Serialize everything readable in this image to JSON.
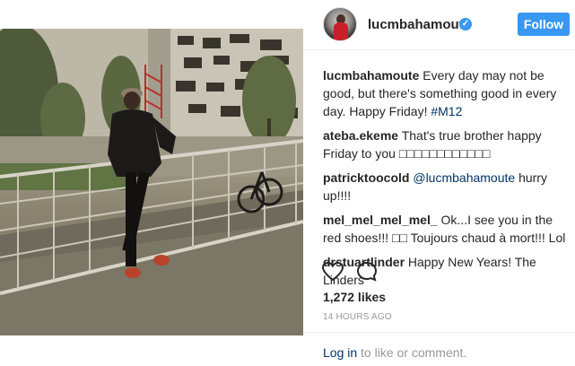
{
  "post": {
    "username": "lucmbahamoute",
    "verified_glyph": "✓",
    "follow_label": "Follow",
    "accent_color": "#3897f0",
    "comments": [
      {
        "author": "lucmbahamoute",
        "text": "Every day may not be good, but there's something good in every day. Happy Friday! ",
        "tag": "#M12"
      },
      {
        "author": "ateba.ekeme",
        "text": "That's true brother happy Friday to you □□□□□□□□□□□□",
        "tag": ""
      },
      {
        "author": "patricktoocold",
        "text": "",
        "tag": "@lucmbahamoute",
        "after_tag": " hurry up!!!!"
      },
      {
        "author": "mel_mel_mel_mel_",
        "text": "Ok...I see you in the red shoes!!! □□ Toujours chaud à mort!!! Lol",
        "tag": ""
      },
      {
        "author": "drstuartlinder",
        "text": "Happy New Years! The Linders",
        "tag": ""
      }
    ],
    "likes": "1,272 likes",
    "timestamp": "14 HOURS AGO",
    "footer": {
      "login": "Log in",
      "rest": " to like or comment."
    }
  }
}
